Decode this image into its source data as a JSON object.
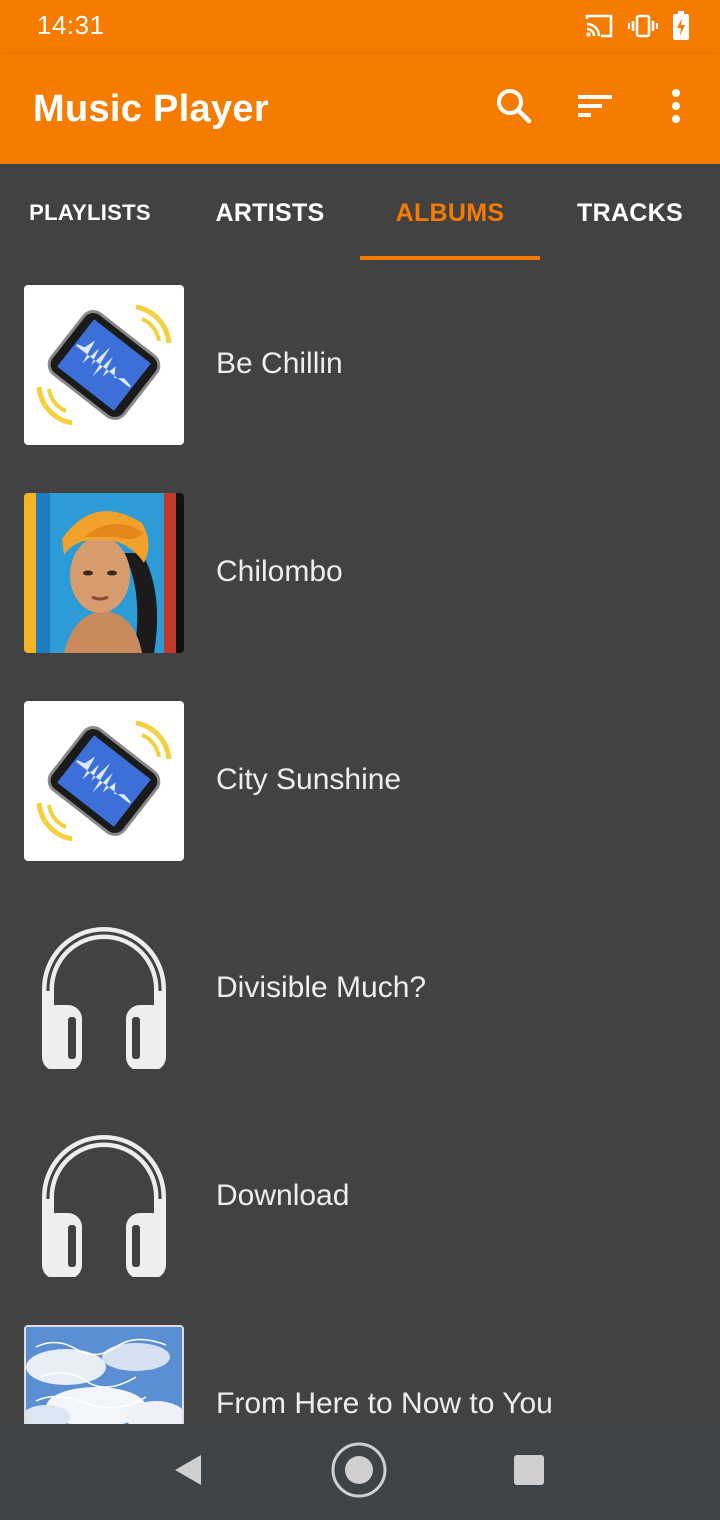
{
  "status_bar": {
    "time": "14:31",
    "icons": [
      "cast-icon",
      "vibrate-icon",
      "battery-charging-icon"
    ]
  },
  "app_bar": {
    "title": "Music Player",
    "actions": [
      "search-icon",
      "sort-icon",
      "more-vert-icon"
    ]
  },
  "tabs": [
    {
      "label": "PLAYLISTS",
      "active": false
    },
    {
      "label": "ARTISTS",
      "active": false
    },
    {
      "label": "ALBUMS",
      "active": true
    },
    {
      "label": "TRACKS",
      "active": false
    }
  ],
  "albums": [
    {
      "title": "Be Chillin",
      "art": "phone-sound-icon"
    },
    {
      "title": "Chilombo",
      "art": "portrait-photo"
    },
    {
      "title": "City Sunshine",
      "art": "phone-sound-icon"
    },
    {
      "title": "Divisible Much?",
      "art": "headphones-icon"
    },
    {
      "title": "Download",
      "art": "headphones-icon"
    },
    {
      "title": "From Here to Now to You",
      "art": "sky-cover-photo"
    }
  ],
  "nav_bar": {
    "buttons": [
      "back-icon",
      "home-icon",
      "recents-icon"
    ]
  },
  "colors": {
    "primary": "#f57c00",
    "background": "#424242",
    "nav_bar": "#3e4348",
    "text": "#eeeeee"
  }
}
